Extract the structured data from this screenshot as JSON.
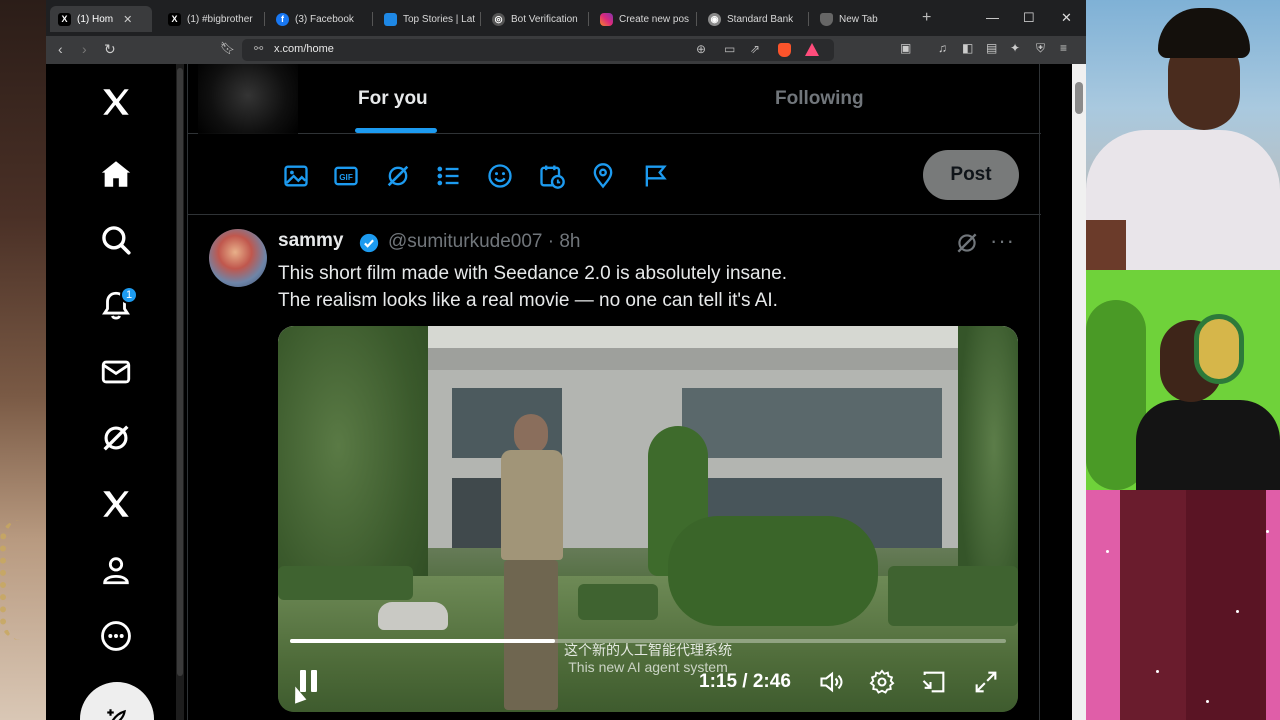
{
  "browser": {
    "tabs": [
      {
        "label": "(1) Hom",
        "active": true,
        "favicon": "x-logo-icon"
      },
      {
        "label": "(1) #bigbrother",
        "active": false,
        "favicon": "x-logo-icon"
      },
      {
        "label": "(3) Facebook",
        "active": false,
        "favicon": "facebook-icon"
      },
      {
        "label": "Top Stories | Lat",
        "active": false,
        "favicon": "news-icon"
      },
      {
        "label": "Bot Verification",
        "active": false,
        "favicon": "shield-icon"
      },
      {
        "label": "Create new pos",
        "active": false,
        "favicon": "instagram-icon"
      },
      {
        "label": "Standard Bank",
        "active": false,
        "favicon": "bank-icon"
      },
      {
        "label": "New Tab",
        "active": false,
        "favicon": "brave-shield-icon"
      }
    ],
    "url": "x.com/home",
    "colors": {
      "tabbar": "#1f2022",
      "toolbar": "#3a3b3d",
      "brave": "#fb542b"
    }
  },
  "x": {
    "nav": {
      "items": [
        "x-logo-icon",
        "home-icon",
        "search-icon",
        "notifications-icon",
        "messages-icon",
        "grok-icon",
        "premium-icon",
        "profile-icon",
        "more-icon"
      ],
      "notification_count": "1"
    },
    "feed_tabs": [
      {
        "label": "For you",
        "active": true
      },
      {
        "label": "Following",
        "active": false
      }
    ],
    "composer": {
      "icons": [
        "image-icon",
        "gif-icon",
        "grok-icon",
        "poll-icon",
        "emoji-icon",
        "schedule-icon",
        "location-icon",
        "flag-icon"
      ],
      "post_label": "Post"
    },
    "tweet": {
      "name": "sammy",
      "handle": "@sumiturkude007 · 8h",
      "text_line1": "This short film made with Seedance 2.0 is absolutely insane.",
      "text_line2": "The realism looks like a real movie — no one can tell it's AI.",
      "video": {
        "current_time": "1:15",
        "duration": "2:46",
        "time_display": "1:15 / 2:46",
        "progress_fraction": 0.37,
        "subtitle_zh": "这个新的人工智能代理系统",
        "subtitle_en": "This new AI agent system"
      }
    },
    "colors": {
      "accent": "#1d9bf0",
      "text": "#e7e9ea",
      "muted": "#71767b",
      "border": "#2f3336",
      "post_button": "#787a7a"
    }
  }
}
